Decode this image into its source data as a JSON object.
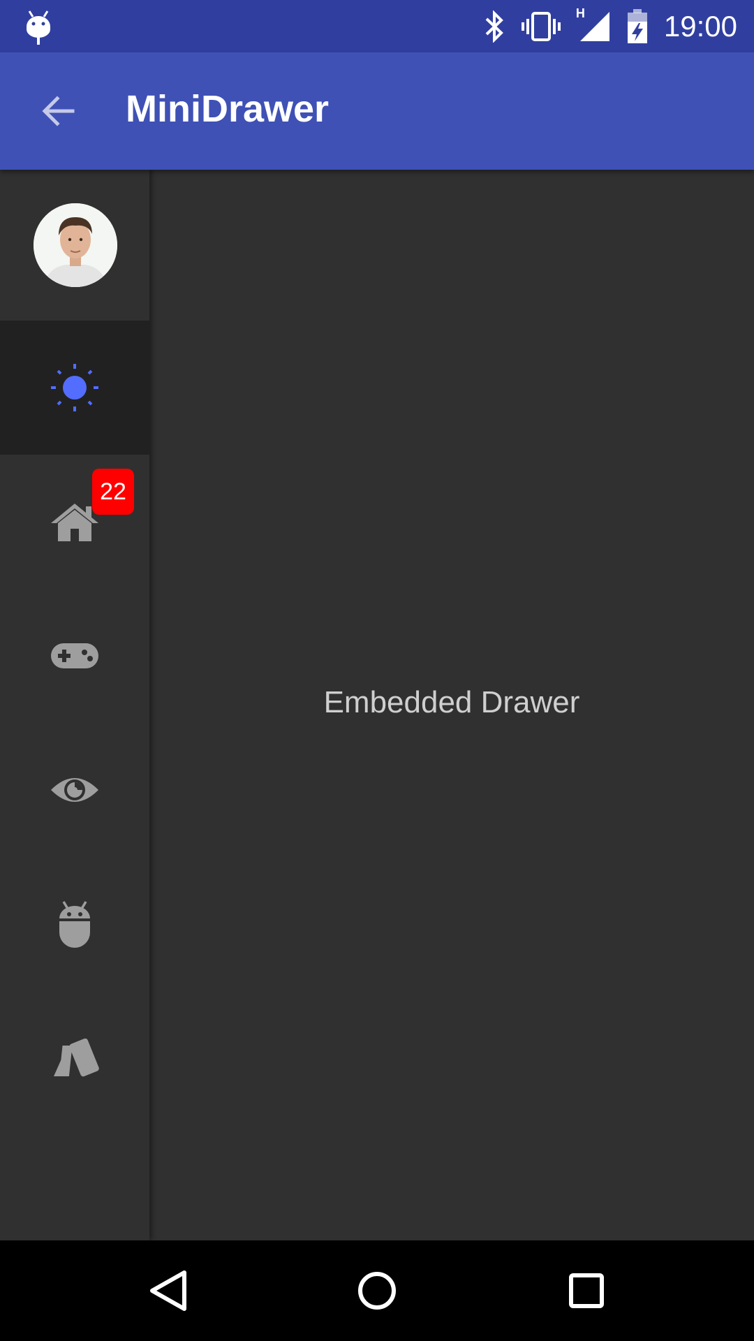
{
  "status_bar": {
    "time": "19:00",
    "network_type": "H",
    "icons": [
      "android-debug-icon",
      "bluetooth-icon",
      "vibrate-icon",
      "signal-icon",
      "battery-charging-icon"
    ]
  },
  "app_bar": {
    "title": "MiniDrawer",
    "nav_icon": "arrow-back-icon"
  },
  "drawer": {
    "items": [
      {
        "icon": "brightness-icon",
        "selected": true,
        "color": "#536DFE"
      },
      {
        "icon": "home-icon",
        "badge": "22"
      },
      {
        "icon": "gamepad-icon"
      },
      {
        "icon": "eye-icon"
      },
      {
        "icon": "android-icon"
      },
      {
        "icon": "cards-icon"
      }
    ],
    "badge_color": "#FF0000"
  },
  "content": {
    "text": "Embedded Drawer"
  },
  "colors": {
    "primary": "#3F51B5",
    "primary_dark": "#303F9F",
    "background": "#303030",
    "selected_item": "#212121",
    "icon_inactive": "#9E9E9E",
    "accent": "#536DFE"
  }
}
